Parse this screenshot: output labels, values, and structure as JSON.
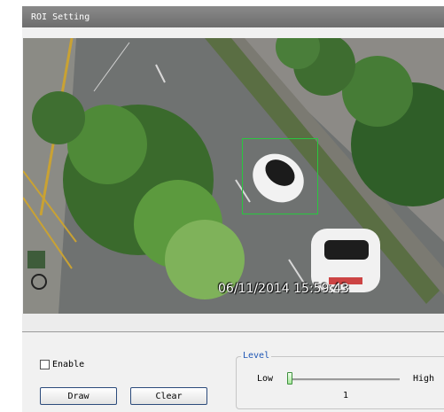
{
  "window": {
    "title": "ROI Setting"
  },
  "video": {
    "timestamp": "06/11/2014 15:59:43"
  },
  "controls": {
    "enable_label": "Enable",
    "enable_checked": false,
    "draw_label": "Draw",
    "clear_label": "Clear"
  },
  "level": {
    "legend": "Level",
    "low_label": "Low",
    "high_label": "High",
    "value": "1"
  },
  "colors": {
    "roi_box": "#29c73f",
    "level_legend": "#1f57b5"
  }
}
